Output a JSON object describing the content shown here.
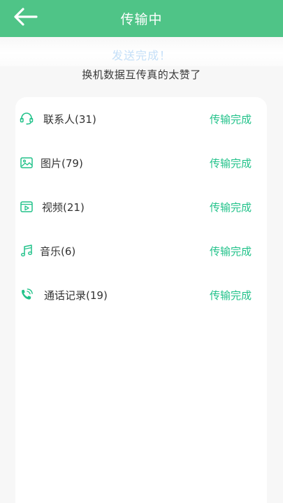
{
  "header": {
    "title": "传输中",
    "back_icon": "arrow-left-icon"
  },
  "status": {
    "text": "发送完成！",
    "color": "#c4dff8"
  },
  "subtitle": "换机数据互传真的太赞了",
  "colors": {
    "accent": "#4fc487",
    "status_green": "#22c28a"
  },
  "items": [
    {
      "icon": "headset-icon",
      "label": "联系人(31)",
      "status": "传输完成"
    },
    {
      "icon": "image-icon",
      "label": "图片(79)",
      "status": "传输完成"
    },
    {
      "icon": "video-icon",
      "label": "视频(21)",
      "status": "传输完成"
    },
    {
      "icon": "music-note-icon",
      "label": "音乐(6)",
      "status": "传输完成"
    },
    {
      "icon": "phone-call-icon",
      "label": "通话记录(19)",
      "status": "传输完成"
    }
  ]
}
